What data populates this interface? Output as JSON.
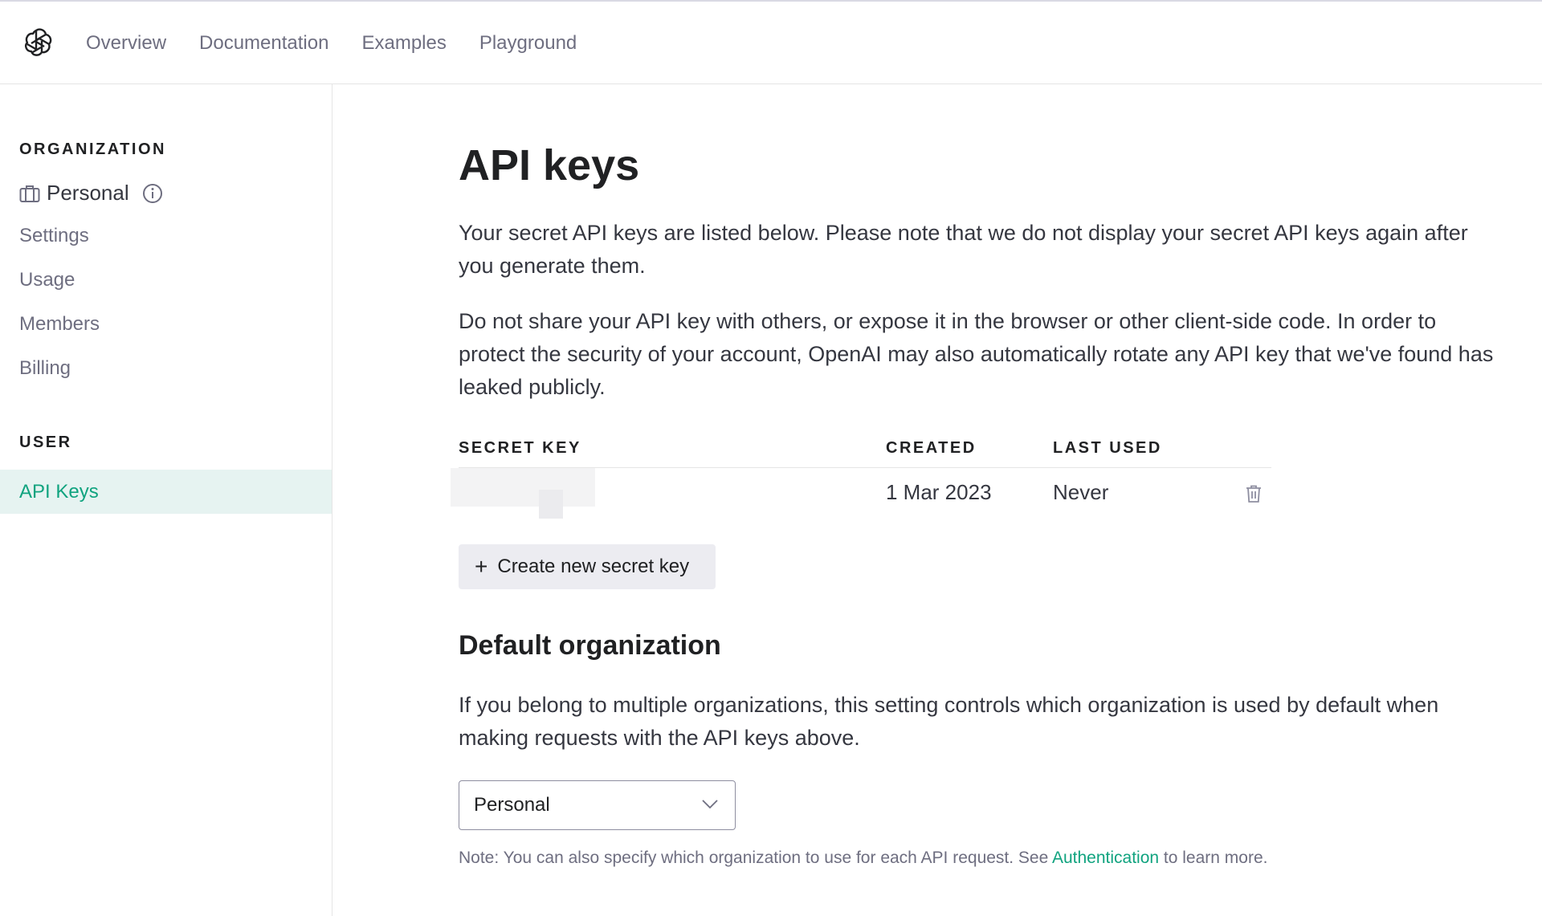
{
  "nav": {
    "items": [
      "Overview",
      "Documentation",
      "Examples",
      "Playground"
    ]
  },
  "sidebar": {
    "org_heading": "ORGANIZATION",
    "org_name": "Personal",
    "links": [
      "Settings",
      "Usage",
      "Members",
      "Billing"
    ],
    "user_heading": "USER",
    "active_link": "API Keys"
  },
  "main": {
    "title": "API keys",
    "para1": "Your secret API keys are listed below. Please note that we do not display your secret API keys again after you generate them.",
    "para2": "Do not share your API key with others, or expose it in the browser or other client-side code. In order to protect the security of your account, OpenAI may also automatically rotate any API key that we've found has leaked publicly.",
    "table": {
      "headers": [
        "SECRET KEY",
        "CREATED",
        "LAST USED"
      ],
      "rows": [
        {
          "created": "1 Mar 2023",
          "last_used": "Never"
        }
      ]
    },
    "create_button": "Create new secret key",
    "default_org_title": "Default organization",
    "default_org_text": "If you belong to multiple organizations, this setting controls which organization is used by default when making requests with the API keys above.",
    "select_value": "Personal",
    "note_prefix": "Note: You can also specify which organization to use for each API request. See ",
    "note_link": "Authentication",
    "note_suffix": " to learn more."
  },
  "colors": {
    "accent": "#10a37f",
    "active_bg": "#e6f3f1",
    "text_dark": "#202123",
    "text_muted": "#6e6e80"
  }
}
